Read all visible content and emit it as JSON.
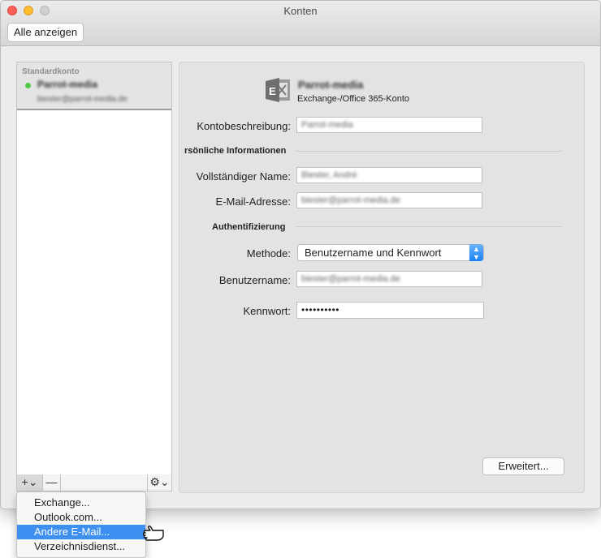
{
  "window": {
    "title": "Konten",
    "show_all_label": "Alle anzeigen"
  },
  "sidebar": {
    "header": "Standardkonto",
    "account": {
      "name": "Parrot-media",
      "email": "biester@parrot-media.de"
    },
    "toolbar": {
      "add": "+⌄",
      "remove": "—",
      "gear": "⚙⌄"
    }
  },
  "account": {
    "name": "Parrot-media",
    "type": "Exchange-/Office 365-Konto",
    "description_label": "Kontobeschreibung:",
    "description_value": "Parrot-media",
    "personal_section": "rsönliche Informationen",
    "fullname_label": "Vollständiger Name:",
    "fullname_value": "Biester, André",
    "email_label": "E-Mail-Adresse:",
    "email_value": "biester@parrot-media.de",
    "auth_section": "Authentifizierung",
    "method_label": "Methode:",
    "method_value": "Benutzername und Kennwort",
    "username_label": "Benutzername:",
    "username_value": "biester@parrot-media.de",
    "password_label": "Kennwort:",
    "password_value": "••••••••••",
    "advanced_label": "Erweitert..."
  },
  "menu": {
    "items": [
      "Exchange...",
      "Outlook.com...",
      "Andere E-Mail...",
      "Verzeichnisdienst..."
    ],
    "selected": "Andere E-Mail..."
  },
  "colors": {
    "accent": "#3d8ff0",
    "status_online": "#55c94c"
  }
}
